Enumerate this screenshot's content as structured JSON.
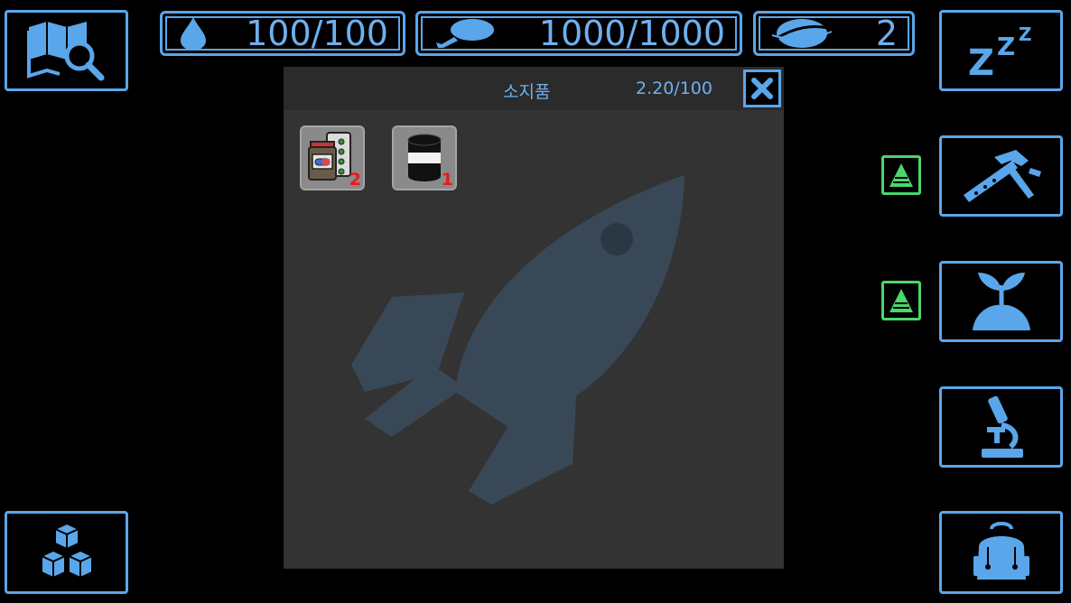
{
  "hud": {
    "water": {
      "icon": "water-drop-icon",
      "value": "100/100"
    },
    "food": {
      "icon": "meat-leg-icon",
      "value": "1000/1000"
    },
    "energy": {
      "icon": "planet-ring-icon",
      "value": "2"
    }
  },
  "left_menu": [
    {
      "icon": "map-search-icon"
    },
    {
      "icon": "cubes-icon"
    }
  ],
  "right_menu": [
    {
      "icon": "sleep-zzz-icon"
    },
    {
      "icon": "hammer-saw-icon",
      "has_alert": true
    },
    {
      "icon": "sprout-icon",
      "has_alert": true
    },
    {
      "icon": "microscope-icon"
    },
    {
      "icon": "backpack-icon"
    }
  ],
  "inventory": {
    "title": "소지품",
    "capacity": "2.20/100",
    "background_icon": "rocket-icon",
    "items": [
      {
        "icon": "medicine-pills-icon",
        "count": "2"
      },
      {
        "icon": "fuel-barrel-icon",
        "count": "1"
      }
    ]
  },
  "colors": {
    "accent": "#5aa6ea",
    "alert": "#4bd66b",
    "count": "#e81b1b",
    "panel": "#333333"
  }
}
